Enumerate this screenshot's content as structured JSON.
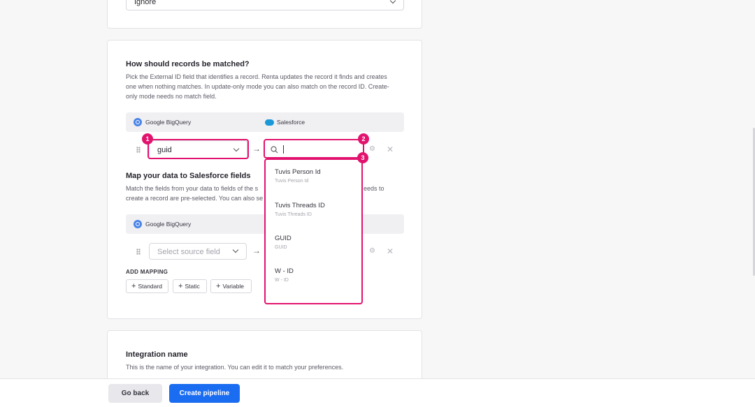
{
  "top_card": {
    "select_value": "Ignore"
  },
  "match": {
    "title": "How should records be matched?",
    "desc_lines": [
      "Pick the External ID field that identifies a record. Renta updates the record it finds and creates",
      "one when nothing matches. In update-only mode you can also match on the record ID. Create-",
      "only mode needs no match field."
    ],
    "source_name": "Google BigQuery",
    "dest_name": "Salesforce",
    "source_field": "guid",
    "search_value": ""
  },
  "mapping": {
    "title": "Map your data to Salesforce fields",
    "desc_line1_left": "Match the fields from your data to fields of the s",
    "desc_line1_right": "eeds to",
    "desc_line2": "create a record are pre-selected. You can also se",
    "source_name": "Google BigQuery",
    "source_placeholder": "Select source field",
    "add_mapping_label": "ADD MAPPING",
    "buttons": [
      "Standard",
      "Static",
      "Variable"
    ]
  },
  "dropdown": {
    "options": [
      {
        "label": "Tuvis Person Id",
        "sub": "Tuvis Person Id"
      },
      {
        "label": "Tuvis Threads ID",
        "sub": "Tuvis Threads ID"
      },
      {
        "label": "GUID",
        "sub": "GUID"
      },
      {
        "label": "W - ID",
        "sub": "W - ID"
      }
    ]
  },
  "badges": [
    "1",
    "2",
    "3"
  ],
  "integration": {
    "title": "Integration name",
    "desc": "This is the name of your integration. You can edit it to match your preferences."
  },
  "footer": {
    "back_label": "Go back",
    "create_label": "Create pipeline"
  },
  "colors": {
    "accent": "#e2136e",
    "primary": "#1a6cf0"
  }
}
